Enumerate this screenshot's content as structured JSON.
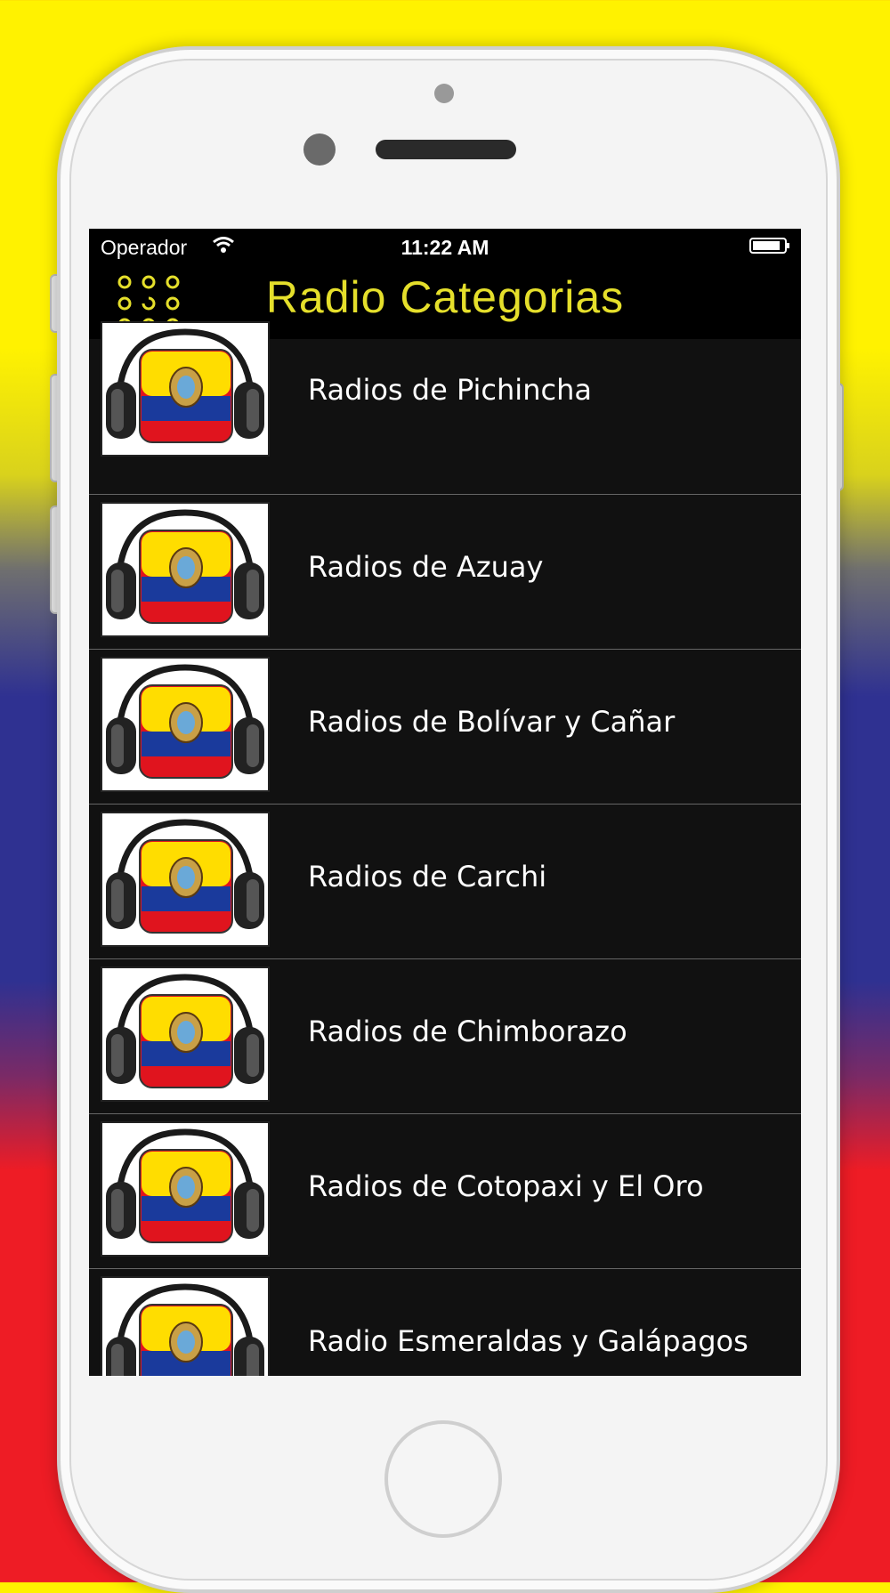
{
  "status_bar": {
    "carrier": "Operador",
    "time": "11:22 AM",
    "wifi_icon": "wifi-icon",
    "battery_icon": "battery-icon"
  },
  "nav": {
    "title": "Radio Categorias",
    "menu_icon": "grid-menu-icon"
  },
  "colors": {
    "title": "#e5df2b",
    "row_background": "#111111",
    "screen_background": "#000000",
    "flag_yellow": "#ffdd00",
    "flag_blue": "#1a3a9c",
    "flag_red": "#e0141e"
  },
  "categories": [
    {
      "label": "Radios de Pichincha"
    },
    {
      "label": "Radios de Azuay"
    },
    {
      "label": "Radios de Bolívar y Cañar"
    },
    {
      "label": "Radios de Carchi"
    },
    {
      "label": "Radios de Chimborazo"
    },
    {
      "label": "Radios de Cotopaxi y El Oro"
    },
    {
      "label": "Radio Esmeraldas y Galápagos"
    }
  ]
}
